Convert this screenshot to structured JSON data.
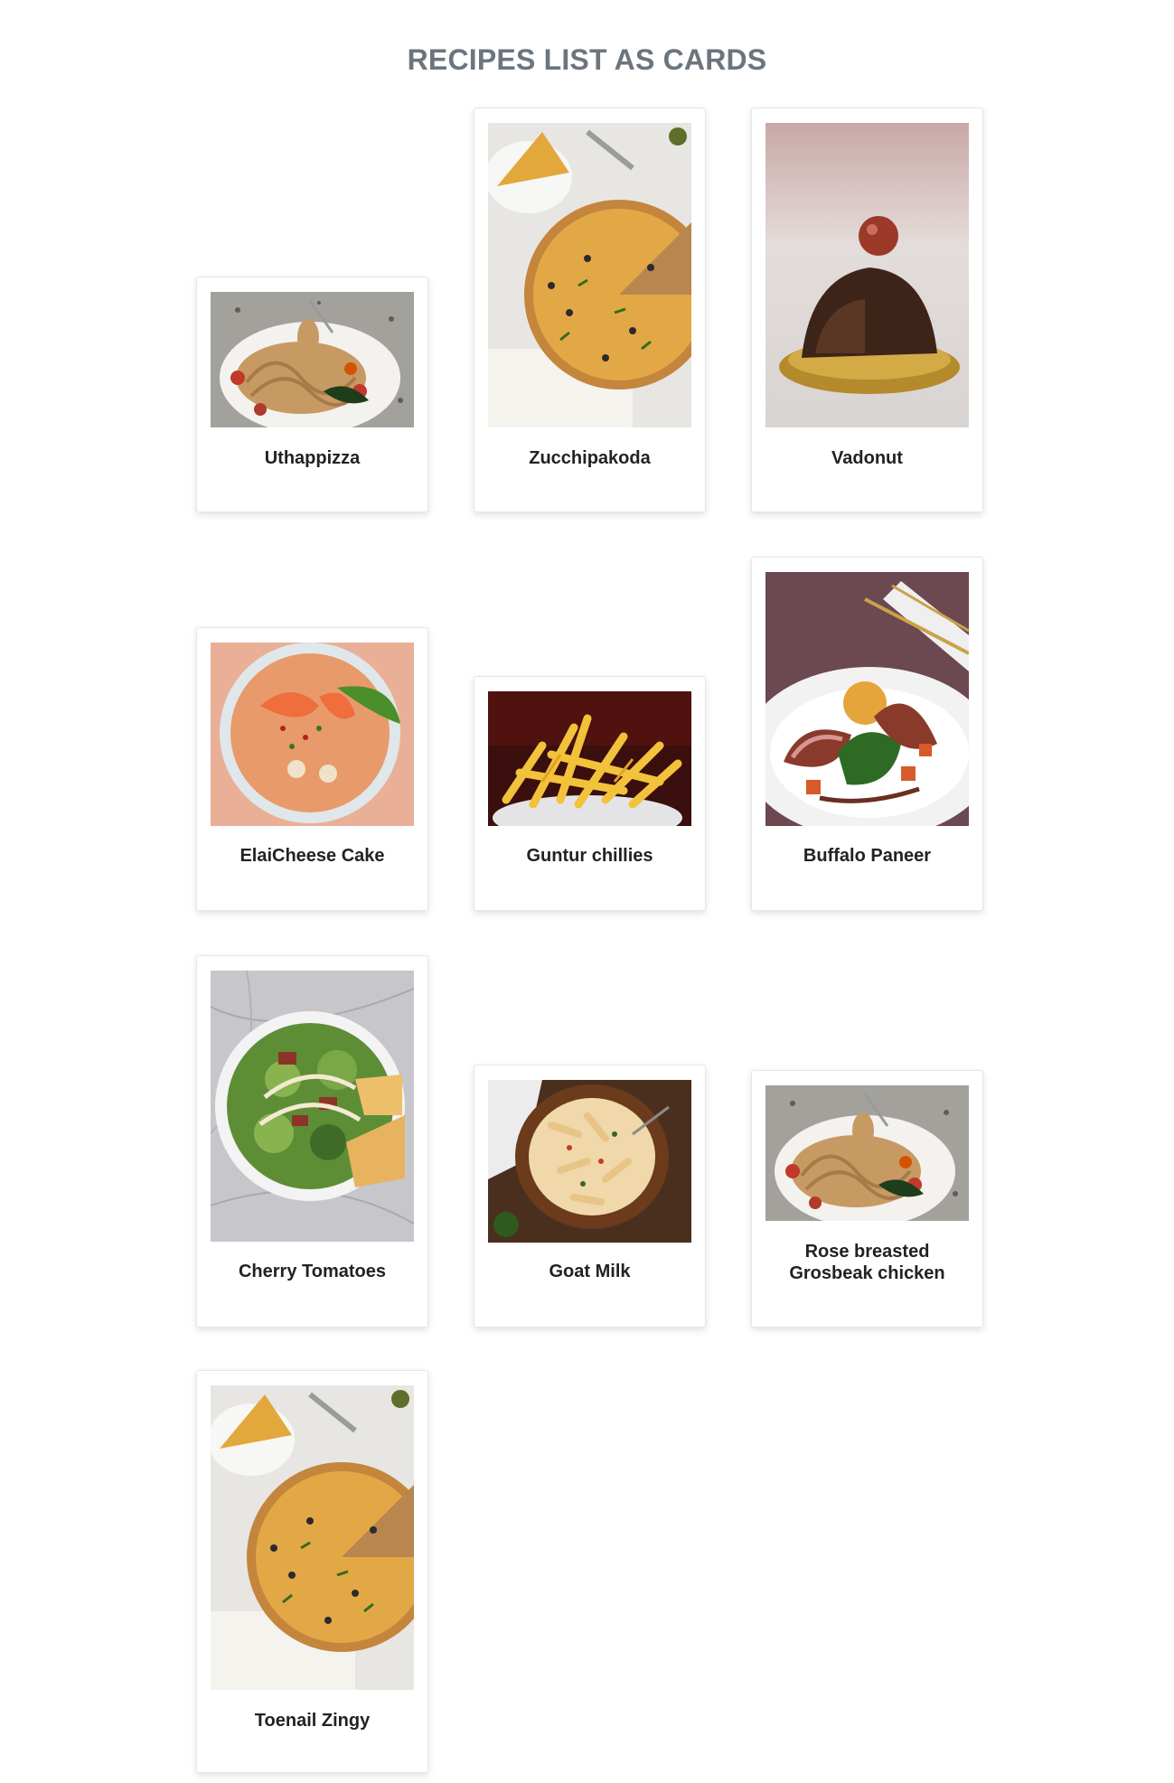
{
  "header": {
    "title": "RECIPES LIST AS CARDS"
  },
  "recipes": [
    {
      "title": "Uthappizza",
      "image": "spaghetti-plate-photo"
    },
    {
      "title": "Zucchipakoda",
      "image": "pizza-photo"
    },
    {
      "title": "Vadonut",
      "image": "chocolate-dome-cake-photo"
    },
    {
      "title": "ElaiCheese Cake",
      "image": "shrimp-noodle-soup-photo"
    },
    {
      "title": "Guntur chillies",
      "image": "french-fries-photo"
    },
    {
      "title": "Buffalo Paneer",
      "image": "duck-breast-plate-photo"
    },
    {
      "title": "Cherry Tomatoes",
      "image": "caesar-salad-photo"
    },
    {
      "title": "Goat Milk",
      "image": "penne-pasta-bowl-photo"
    },
    {
      "title": "Rose breasted\nGrosbeak chicken",
      "image": "spaghetti-plate-photo"
    },
    {
      "title": "Toenail Zingy",
      "image": "pizza-photo"
    }
  ]
}
